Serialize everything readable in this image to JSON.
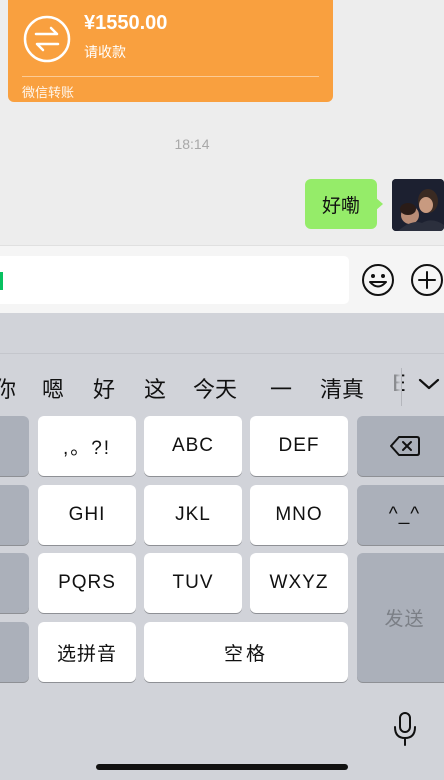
{
  "transfer": {
    "amount": "¥1550.00",
    "status": "请收款",
    "source": "微信转账"
  },
  "timestamp": "18:14",
  "message": {
    "text": "好嘞"
  },
  "input": {
    "value": ""
  },
  "candidates": [
    "你",
    "嗯",
    "好",
    "这",
    "今天",
    "一",
    "清真",
    "E"
  ],
  "keys": {
    "punct": ",。?!",
    "abc": "ABC",
    "def": "DEF",
    "ghi": "GHI",
    "jkl": "JKL",
    "mno": "MNO",
    "pqrs": "PQRS",
    "tuv": "TUV",
    "wxyz": "WXYZ",
    "pinyin": "选拼音",
    "space": "空格",
    "emoticon": "^_^",
    "send": "发送"
  },
  "colors": {
    "transfer": "#f9a03f",
    "bubble": "#95ec69",
    "accent": "#07c160"
  }
}
